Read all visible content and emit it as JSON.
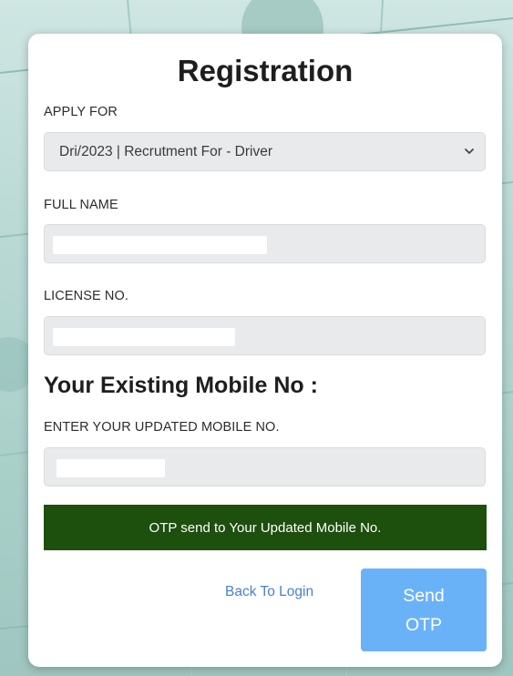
{
  "form": {
    "title": "Registration",
    "apply_for": {
      "label": "APPLY FOR",
      "selected": "Dri/2023 | Recrutment For - Driver"
    },
    "full_name": {
      "label": "FULL NAME",
      "value": ""
    },
    "license_no": {
      "label": "LICENSE NO.",
      "value": ""
    },
    "mobile_heading": "Your Existing Mobile No :",
    "updated_mobile": {
      "label": "ENTER YOUR UPDATED MOBILE NO.",
      "value": ""
    },
    "notice": "OTP send to Your Updated Mobile No.",
    "back_link": "Back To Login",
    "send_button": {
      "line1": "Send",
      "line2": "OTP"
    }
  },
  "colors": {
    "notice_bg": "#1d4f0d",
    "button_bg": "#6ab2f8",
    "link": "#4a7fd0",
    "field_bg": "#e9eaec"
  },
  "icons": {
    "select_arrow": "chevron-down-icon"
  }
}
